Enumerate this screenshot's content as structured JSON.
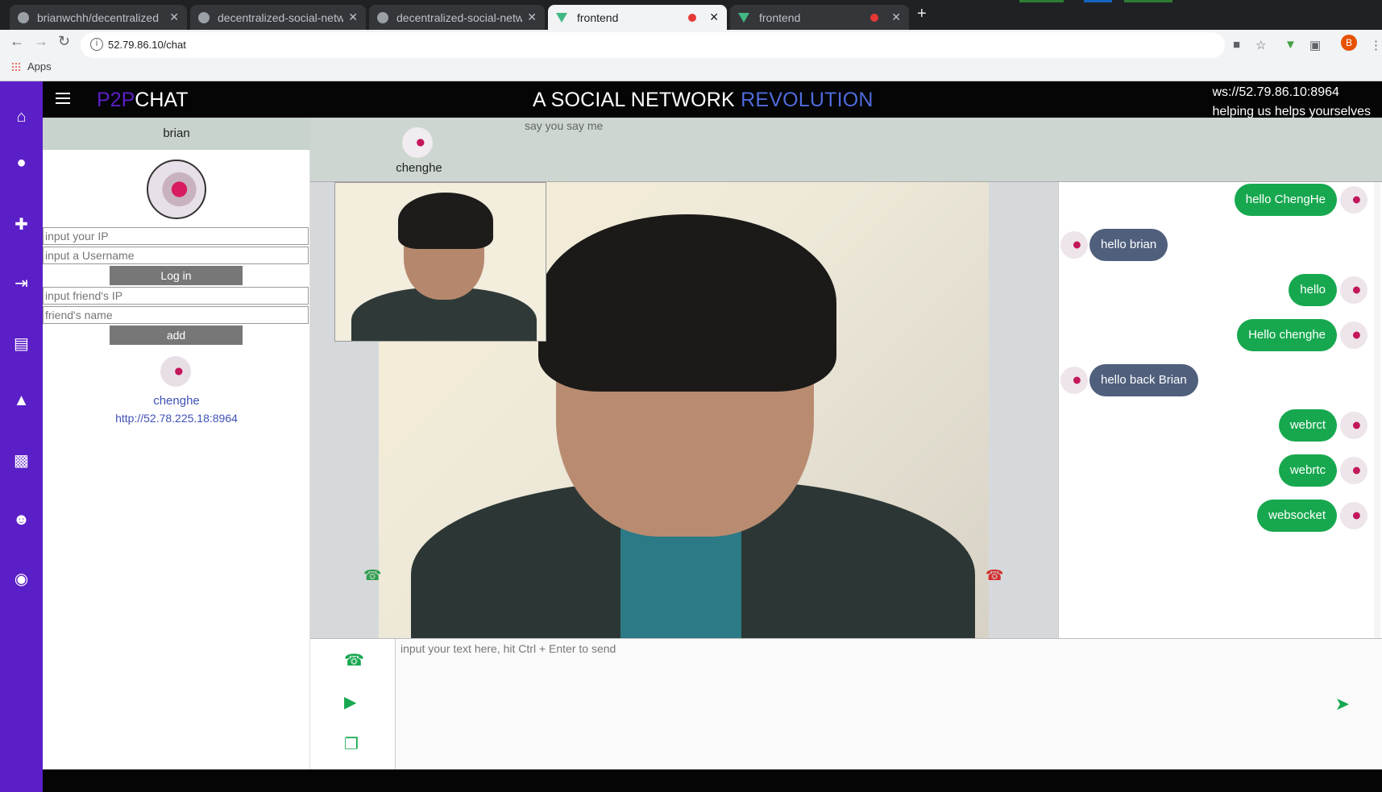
{
  "browser": {
    "tabs": [
      {
        "title": "brianwchh/decentralized",
        "active": false
      },
      {
        "title": "decentralized-social-netw",
        "active": false
      },
      {
        "title": "decentralized-social-netw",
        "active": false
      },
      {
        "title": "frontend",
        "active": true
      },
      {
        "title": "frontend",
        "active": false
      }
    ],
    "url": "52.79.86.10/chat",
    "bookmarks_label": "Apps",
    "profile_initial": "B"
  },
  "app": {
    "logo_part1": "P2P",
    "logo_part2": "CHAT",
    "slogan_part1": "A SOCIAL NETWORK",
    "slogan_part2": "REVOLUTION",
    "ws_address": "ws://52.79.86.10:8964",
    "tagline": "helping us helps yourselves"
  },
  "left_panel": {
    "username": "brian",
    "ip_placeholder": "input your IP",
    "username_placeholder": "input a Username",
    "login_label": "Log in",
    "friend_ip_placeholder": "input friend's IP",
    "friend_name_placeholder": "friend's name",
    "add_label": "add",
    "friends": [
      {
        "name": "chenghe",
        "address": "http://52.78.225.18:8964"
      }
    ]
  },
  "chat": {
    "contact_name": "chenghe",
    "status": "say you say me",
    "messages": [
      {
        "text": "hello ChengHe",
        "direction": "out"
      },
      {
        "text": "hello brian",
        "direction": "in"
      },
      {
        "text": "hello",
        "direction": "out"
      },
      {
        "text": "Hello chenghe",
        "direction": "out"
      },
      {
        "text": "hello back Brian",
        "direction": "in"
      },
      {
        "text": "webrct",
        "direction": "out"
      },
      {
        "text": "webrtc",
        "direction": "out"
      },
      {
        "text": "websocket",
        "direction": "out"
      }
    ],
    "input_placeholder": "input your text here, hit Ctrl + Enter to send"
  },
  "colors": {
    "brand_purple": "#5b1fc7",
    "accent_blue": "#4f6bdb",
    "sent_green": "#17a84f",
    "received_slate": "#4f5f7c"
  }
}
